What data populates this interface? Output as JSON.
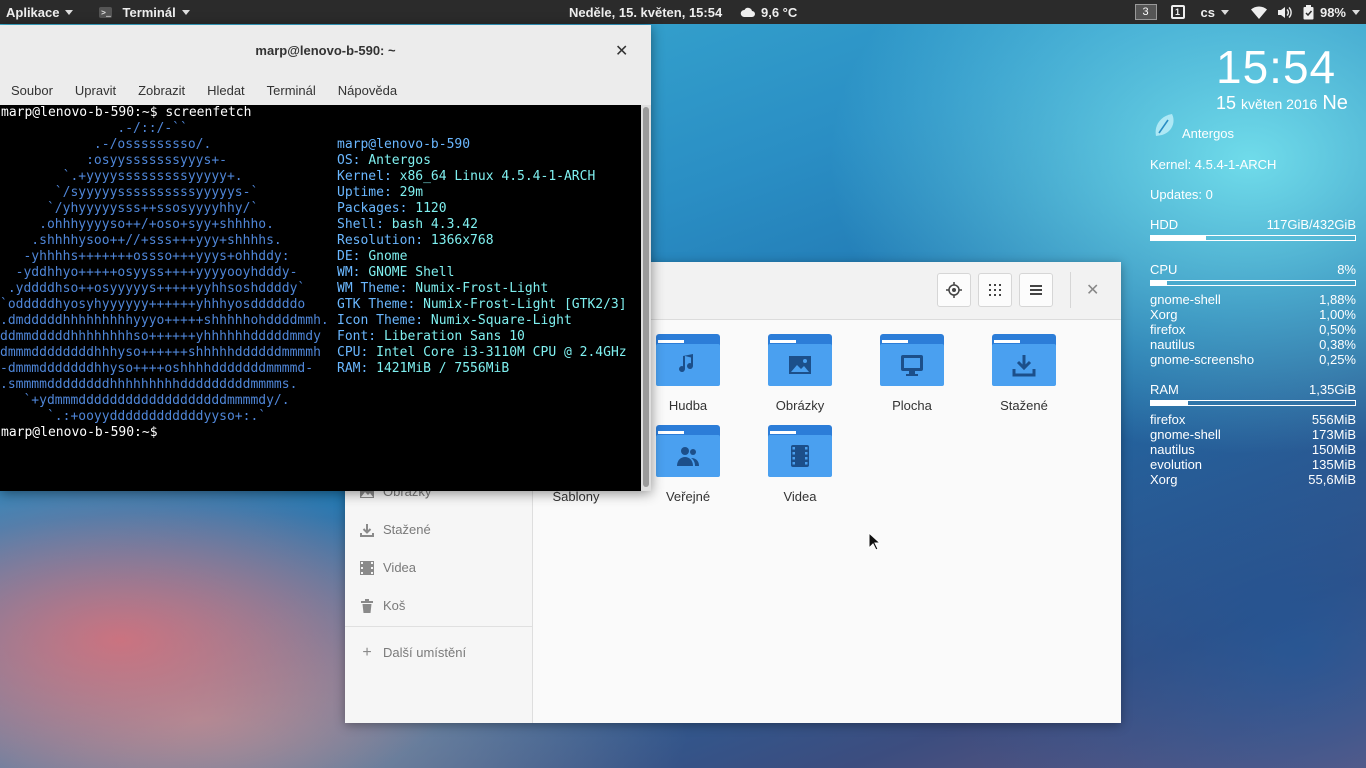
{
  "topbar": {
    "apps_label": "Aplikace",
    "app_name": "Terminál",
    "clock": "Neděle, 15. květen, 15:54",
    "weather": "9,6 °C",
    "workspace": "3",
    "keyboard_icon": "1",
    "language": "cs",
    "battery": "98%"
  },
  "terminal": {
    "title": "marp@lenovo-b-590: ~",
    "menu": [
      "Soubor",
      "Upravit",
      "Zobrazit",
      "Hledat",
      "Terminál",
      "Nápověda"
    ],
    "prompt1": "marp@lenovo-b-590:~$ screenfetch",
    "prompt2": "marp@lenovo-b-590:~$",
    "ascii": [
      "               .-/::/-``",
      "            .-/osssssssso/.",
      "           :osyysssssssyyys+-",
      "        `.+yyyysssssssssyyyyy+.",
      "       `/syyyyyssssssssssyyyyys-`",
      "      `/yhyyyyysss++ssosyyyyhhy/`",
      "     .ohhhyyyyso++/+oso+syy+shhhho.",
      "    .shhhhysoo++//+sss+++yyy+shhhhs.",
      "   -yhhhhs+++++++ossso+++yyys+ohhddy:",
      "  -yddhhyo+++++osyyss++++yyyyooyhdddy-",
      " .yddddhso++osyyyyys+++++yyhhsoshddddy`",
      "`odddddhyosyhyyyyyy++++++yhhhyosddddddo",
      ".dmdddddhhhhhhhhhyyyo+++++shhhhhohddddmmh.",
      "ddmmdddddhhhhhhhhso++++++yhhhhhhdddddmmdy",
      "dmmmddddddddhhhyso++++++shhhhhddddddmmmmh",
      "-dmmmdddddddhhyso++++oshhhhdddddddmmmmd-",
      ".smmmmddddddddhhhhhhhhhdddddddddmmmms.",
      "   `+ydmmmdddddddddddddddddddmmmmdy/.",
      "      `.:+ooyyddddddddddddyyso+:.`"
    ],
    "info": [
      {
        "k": "",
        "v": "marp@lenovo-b-590"
      },
      {
        "k": "OS: ",
        "v": "Antergos"
      },
      {
        "k": "Kernel: ",
        "v": "x86_64 Linux 4.5.4-1-ARCH"
      },
      {
        "k": "Uptime: ",
        "v": "29m"
      },
      {
        "k": "Packages: ",
        "v": "1120"
      },
      {
        "k": "Shell: ",
        "v": "bash 4.3.42"
      },
      {
        "k": "Resolution: ",
        "v": "1366x768"
      },
      {
        "k": "DE: ",
        "v": "Gnome"
      },
      {
        "k": "WM: ",
        "v": "GNOME Shell"
      },
      {
        "k": "WM Theme: ",
        "v": "Numix-Frost-Light"
      },
      {
        "k": "GTK Theme: ",
        "v": "Numix-Frost-Light [GTK2/3]"
      },
      {
        "k": "Icon Theme: ",
        "v": "Numix-Square-Light"
      },
      {
        "k": "Font: ",
        "v": "Liberation Sans 10"
      },
      {
        "k": "CPU: ",
        "v": "Intel Core i3-3110M CPU @ 2.4GHz"
      },
      {
        "k": "RAM: ",
        "v": "1421MiB / 7556MiB"
      }
    ]
  },
  "files": {
    "sidebar": [
      {
        "label": "Obrázky",
        "icon": "image-icon"
      },
      {
        "label": "Stažené",
        "icon": "download-icon"
      },
      {
        "label": "Videa",
        "icon": "film-icon"
      },
      {
        "label": "Koš",
        "icon": "trash-icon"
      }
    ],
    "other_locations": "Další umístění",
    "folders": [
      {
        "label": "Hudba",
        "icon": "music-icon"
      },
      {
        "label": "Obrázky",
        "icon": "image-icon"
      },
      {
        "label": "Plocha",
        "icon": "desktop-icon"
      },
      {
        "label": "Stažené",
        "icon": "download-icon"
      },
      {
        "label": "Šablony",
        "icon": "template-icon"
      },
      {
        "label": "Veřejné",
        "icon": "people-icon"
      },
      {
        "label": "Videa",
        "icon": "film-icon"
      }
    ]
  },
  "conky": {
    "time": "15:54",
    "day": "15",
    "month_year": "květen 2016",
    "weekday": "Ne",
    "distro": "Antergos",
    "kernel": "Kernel: 4.5.4-1-ARCH",
    "updates": "Updates: 0",
    "hdd_label": "HDD",
    "hdd_value": "117GiB/432GiB",
    "hdd_fraction": 0.27,
    "cpu_label": "CPU",
    "cpu_value": "8%",
    "cpu_fraction": 0.08,
    "cpu_procs": [
      {
        "name": "gnome-shell",
        "val": "1,88%"
      },
      {
        "name": "Xorg",
        "val": "1,00%"
      },
      {
        "name": "firefox",
        "val": "0,50%"
      },
      {
        "name": "nautilus",
        "val": "0,38%"
      },
      {
        "name": "gnome-screensho",
        "val": "0,25%"
      }
    ],
    "ram_label": "RAM",
    "ram_value": "1,35GiB",
    "ram_fraction": 0.18,
    "ram_procs": [
      {
        "name": "firefox",
        "val": "556MiB"
      },
      {
        "name": "gnome-shell",
        "val": "173MiB"
      },
      {
        "name": "nautilus",
        "val": "150MiB"
      },
      {
        "name": "evolution",
        "val": "135MiB"
      },
      {
        "name": "Xorg",
        "val": "55,6MiB"
      }
    ]
  }
}
